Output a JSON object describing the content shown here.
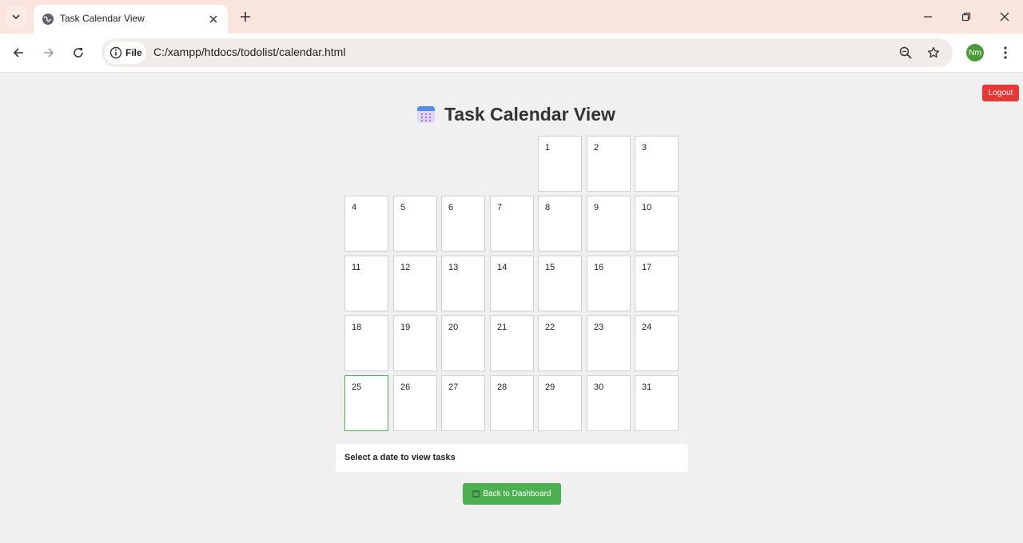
{
  "browser": {
    "tab_title": "Task Calendar View",
    "site_chip": "File",
    "url": "C:/xampp/htdocs/todolist/calendar.html",
    "profile_initials": "Nm"
  },
  "page": {
    "logout_label": "Logout",
    "title": "Task Calendar View",
    "leading_blank_days": 4,
    "days": [
      "1",
      "2",
      "3",
      "4",
      "5",
      "6",
      "7",
      "8",
      "9",
      "10",
      "11",
      "12",
      "13",
      "14",
      "15",
      "16",
      "17",
      "18",
      "19",
      "20",
      "21",
      "22",
      "23",
      "24",
      "25",
      "26",
      "27",
      "28",
      "29",
      "30",
      "31"
    ],
    "highlighted_day": "25",
    "info_text": "Select a date to view tasks",
    "back_label": "Back to Dashboard"
  },
  "colors": {
    "accent": "#4caf50",
    "logout": "#e53935",
    "tabbar": "#f9e4de"
  }
}
